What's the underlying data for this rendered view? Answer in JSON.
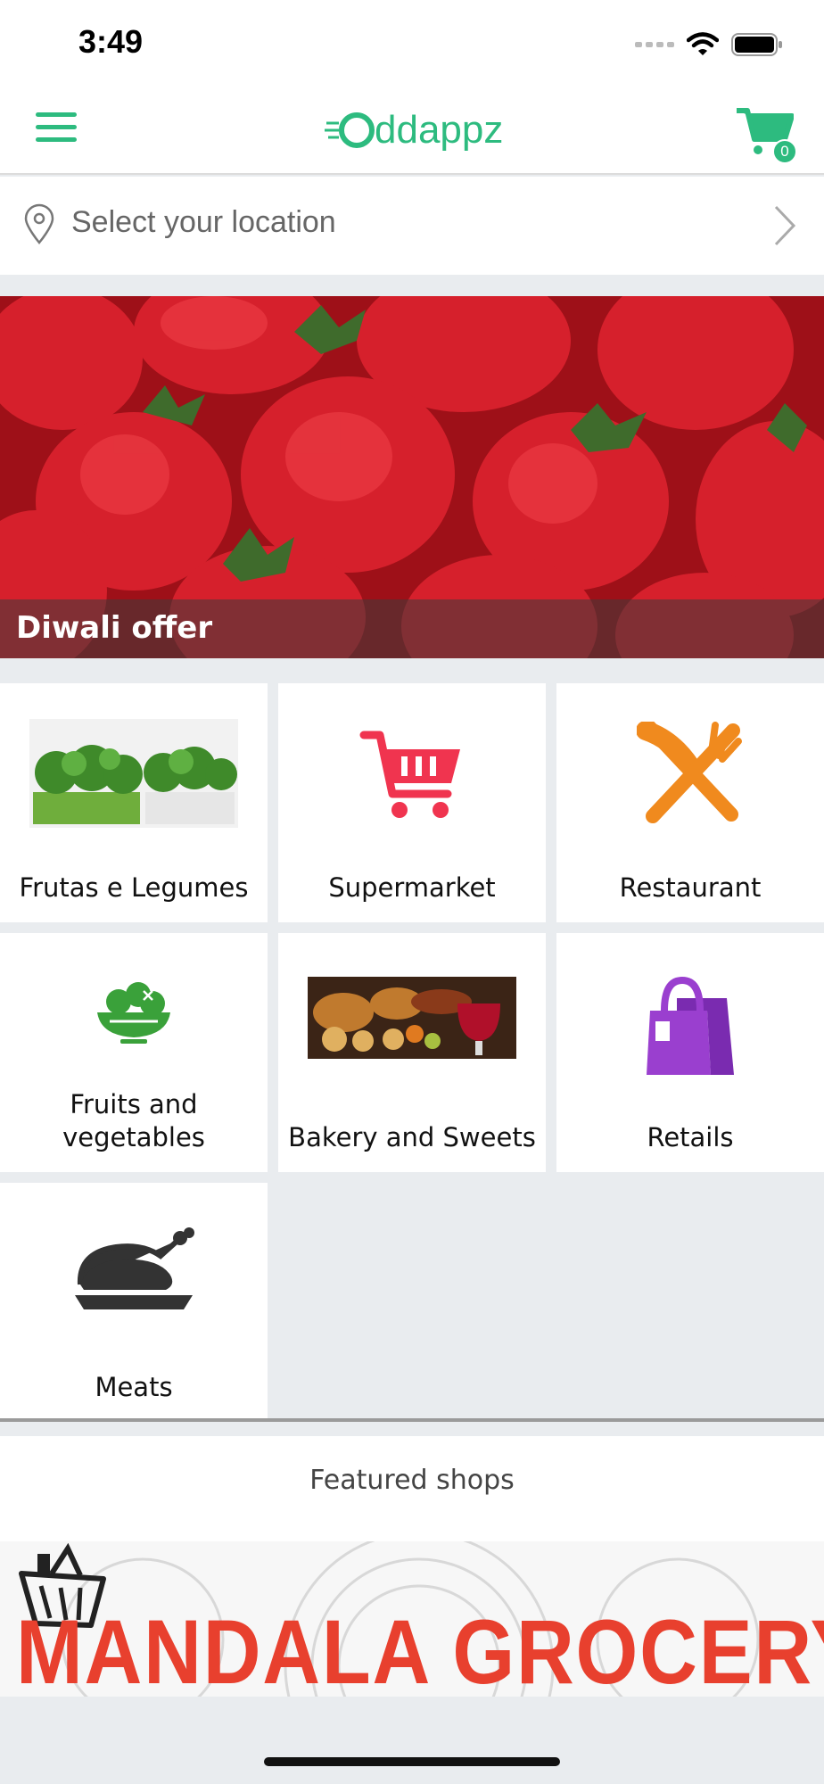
{
  "status_bar": {
    "time": "3:49"
  },
  "header": {
    "logo_text": "Oddappz",
    "cart_count": "0",
    "brand_color": "#2dbb7f"
  },
  "location": {
    "placeholder": "Select your location"
  },
  "banner": {
    "title": "Diwali offer"
  },
  "categories": [
    {
      "label": "Frutas e Legumes",
      "icon": "vegetables-photo"
    },
    {
      "label": "Supermarket",
      "icon": "shopping-cart-icon",
      "color": "#f0344f"
    },
    {
      "label": "Restaurant",
      "icon": "knife-fork-icon",
      "color": "#f08a1e"
    },
    {
      "label": "Fruits and vegetables",
      "icon": "salad-bowl-icon",
      "color": "#3aa13a"
    },
    {
      "label": "Bakery and Sweets",
      "icon": "bakery-photo"
    },
    {
      "label": "Retails",
      "icon": "shopping-bag-icon",
      "color": "#9a3fcf"
    },
    {
      "label": "Meats",
      "icon": "roast-chicken-icon",
      "color": "#333333"
    }
  ],
  "featured": {
    "title": "Featured shops",
    "shops": [
      {
        "name": "MANDALA GROCERY"
      }
    ]
  }
}
